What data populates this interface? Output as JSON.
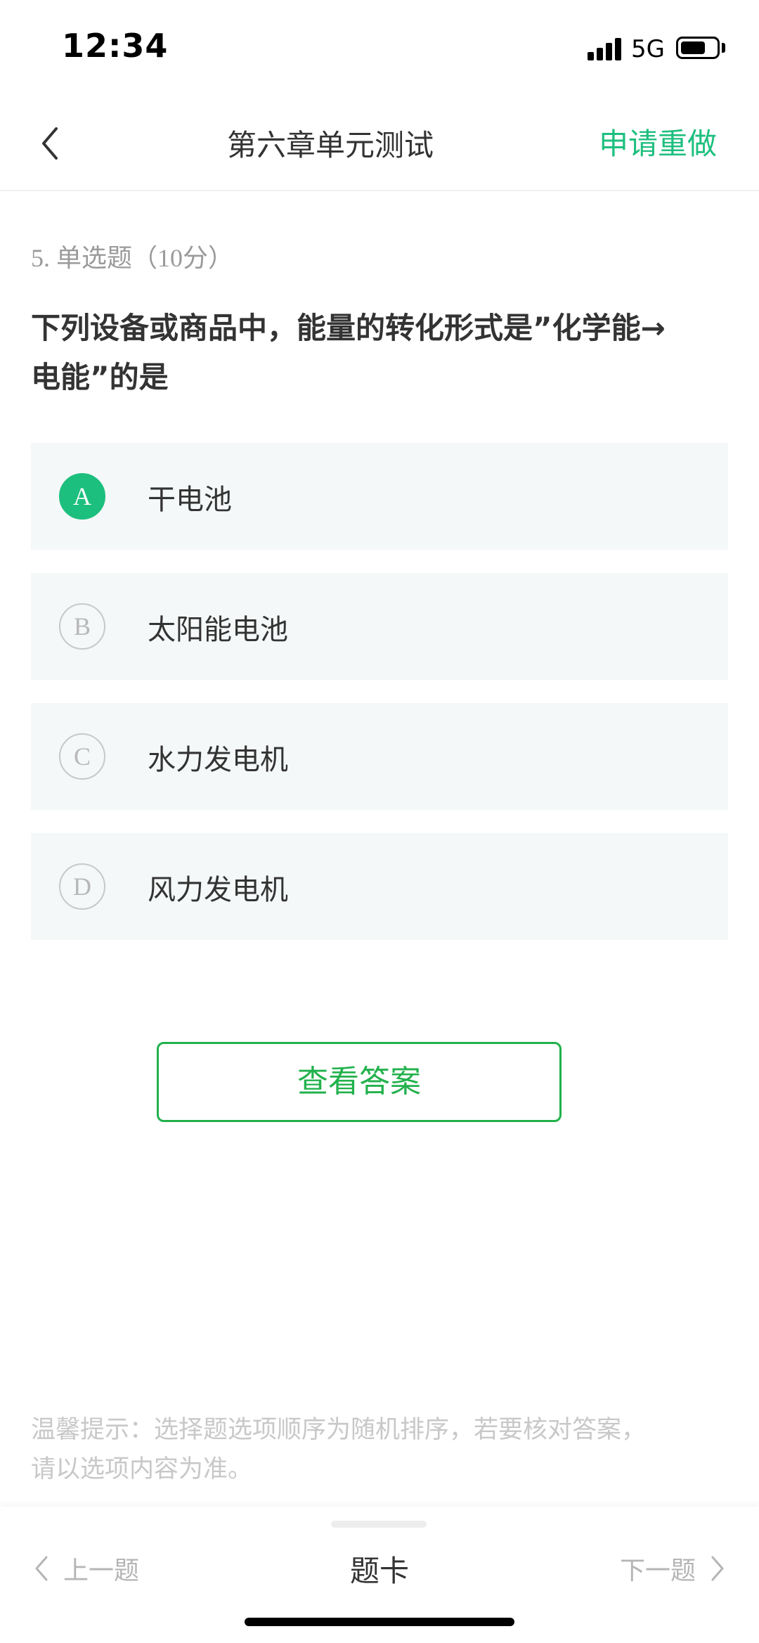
{
  "status_bar": {
    "time": "12:34",
    "network": "5G",
    "battery_level": 0.7
  },
  "nav": {
    "title": "第六章单元测试",
    "action_label": "申请重做",
    "accent_color": "#1dbf7e"
  },
  "question": {
    "meta": "5. 单选题（10分）",
    "text_line1": "下列设备或商品中，能量的转化形式是”化学能→",
    "text_line2": "电能”的是",
    "options": [
      {
        "letter": "A",
        "text": "干电池",
        "selected": true
      },
      {
        "letter": "B",
        "text": "太阳能电池",
        "selected": false
      },
      {
        "letter": "C",
        "text": "水力发电机",
        "selected": false
      },
      {
        "letter": "D",
        "text": "风力发电机",
        "selected": false
      }
    ]
  },
  "answer_button": {
    "label": "查看答案",
    "color": "#22b14c"
  },
  "tip": {
    "line1": "温馨提示：选择题选项顺序为随机排序，若要核对答案，",
    "line2": "请以选项内容为准。"
  },
  "bottom_bar": {
    "prev_label": "上一题",
    "card_label": "题卡",
    "next_label": "下一题"
  }
}
